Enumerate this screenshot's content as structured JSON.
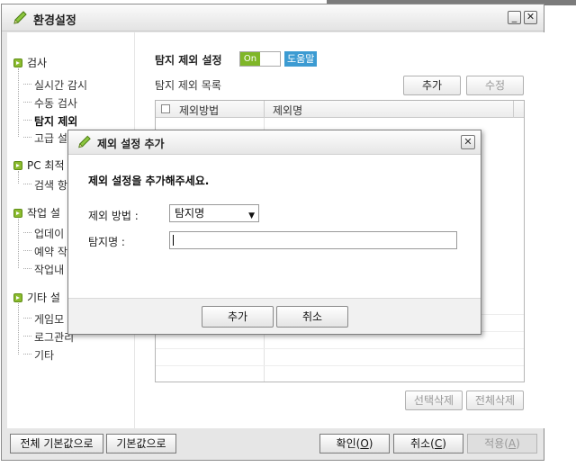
{
  "window": {
    "title": "환경설정",
    "minimize_label": "_",
    "close_label": "✕"
  },
  "sidebar": {
    "categories": [
      {
        "label": "검사",
        "items": [
          "실시간 감시",
          "수동 검사",
          "탐지 제외",
          "고급 설정"
        ]
      },
      {
        "label": "PC 최적화",
        "items": [
          "검색 항목"
        ]
      },
      {
        "label": "작업 설정",
        "items": [
          "업데이트",
          "예약 작업",
          "작업내역"
        ]
      },
      {
        "label": "기타 설정",
        "items": [
          "게임모드",
          "로그관리",
          "기타"
        ]
      }
    ],
    "visible": {
      "cat0": "검사",
      "cat0_item0": "실시간 감시",
      "cat0_item1": "수동 검사",
      "cat0_item2": "탐지 제외",
      "cat0_item3": "고급 설",
      "cat1": "PC 최적",
      "cat1_item0": "검색 항",
      "cat2": "작업 설",
      "cat2_item0": "업데이",
      "cat2_item1": "예약 작",
      "cat2_item2": "작업내",
      "cat3": "기타 설",
      "cat3_item0": "게임모",
      "cat3_item1": "로그관리",
      "cat3_item2": "기타"
    }
  },
  "main": {
    "section_title": "탐지 제외 설정",
    "toggle_label": "On",
    "toggle_state": "on",
    "help_label": "도움말",
    "list_title": "탐지 제외 목록",
    "add_label": "추가",
    "edit_label": "수정",
    "table": {
      "columns": [
        "제외방법",
        "제외명"
      ],
      "rows": []
    },
    "delete_selected_label": "선택삭제",
    "delete_all_label": "전체삭제"
  },
  "footer": {
    "reset_all_label": "전체 기본값으로",
    "reset_label": "기본값으로",
    "ok_label": "확인(",
    "ok_key": "O",
    "cancel_label": "취소(",
    "cancel_key": "C",
    "apply_label": "적용(",
    "apply_key": "A",
    "paren_close": ")"
  },
  "dialog": {
    "title": "제외 설정 추가",
    "message": "제외 설정을 추가해주세요.",
    "method_label": "제외 방법 :",
    "method_value": "탐지명",
    "name_label": "탐지명 :",
    "name_value": "",
    "add_label": "추가",
    "cancel_label": "취소",
    "close_label": "✕"
  },
  "colors": {
    "toggle_on": "#7fb628",
    "help_button": "#3c9bd2",
    "bullet": "#8bbb2e"
  }
}
